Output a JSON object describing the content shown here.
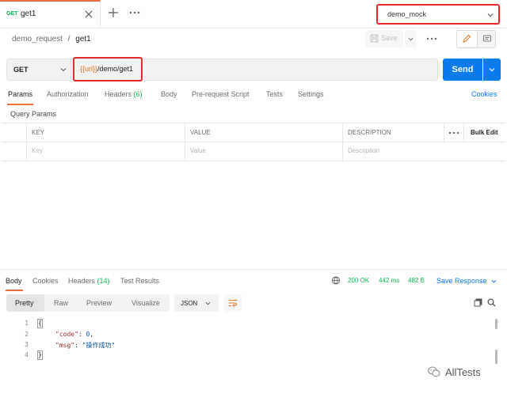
{
  "tab": {
    "method": "GET",
    "name": "get1"
  },
  "environment": {
    "selected": "demo_mock"
  },
  "breadcrumb": {
    "collection": "demo_request",
    "separator": "/",
    "request": "get1"
  },
  "toolbar": {
    "save_label": "Save"
  },
  "request": {
    "method": "GET",
    "url_var": "{{url}}",
    "url_path": "/demo/get1",
    "send_label": "Send"
  },
  "request_tabs": [
    {
      "label": "Params",
      "active": true
    },
    {
      "label": "Authorization"
    },
    {
      "label": "Headers",
      "count": "(6)"
    },
    {
      "label": "Body"
    },
    {
      "label": "Pre-request Script"
    },
    {
      "label": "Tests"
    },
    {
      "label": "Settings"
    }
  ],
  "cookies_label": "Cookies",
  "query_params": {
    "title": "Query Params",
    "columns": [
      "KEY",
      "VALUE",
      "DESCRIPTION"
    ],
    "bulk_edit": "Bulk Edit",
    "placeholders": [
      "Key",
      "Value",
      "Description"
    ]
  },
  "response_tabs": [
    {
      "label": "Body",
      "active": true
    },
    {
      "label": "Cookies"
    },
    {
      "label": "Headers",
      "count": "(14)"
    },
    {
      "label": "Test Results"
    }
  ],
  "response_status": {
    "status": "200 OK",
    "time": "442 ms",
    "size": "482 B"
  },
  "save_response_label": "Save Response",
  "body_formats": [
    "Pretty",
    "Raw",
    "Preview",
    "Visualize"
  ],
  "body_language": "JSON",
  "code": {
    "line_numbers": [
      "1",
      "2",
      "3",
      "4"
    ],
    "open": "{",
    "key1": "\"code\"",
    "val1": "0",
    "key2": "\"msg\"",
    "val2": "\"操作成功\"",
    "close": "}"
  },
  "watermark": "AllTests",
  "colors": {
    "accent": "#f26b3a",
    "send": "#097bed",
    "ok": "#0cbb52",
    "highlight": "#e12c2c"
  }
}
